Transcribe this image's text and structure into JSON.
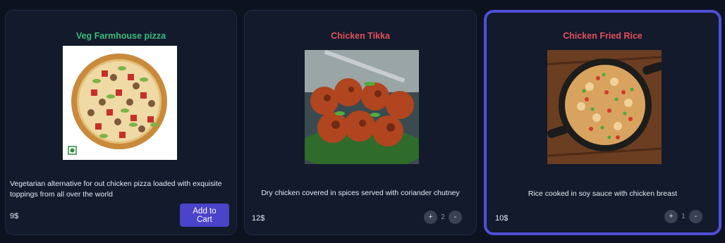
{
  "products": [
    {
      "title": "Veg Farmhouse pizza",
      "title_color": "#3dbb7a",
      "image_icon": "veg-pizza-image",
      "description": "Vegetarian alternative for out chicken pizza loaded with exquisite toppings from all over the world",
      "price": "9$",
      "action": {
        "type": "add",
        "label": "Add to Cart"
      }
    },
    {
      "title": "Chicken Tikka",
      "title_color": "#e2505a",
      "image_icon": "chicken-tikka-image",
      "description": "Dry chicken covered in spices served with coriander chutney",
      "price": "12$",
      "action": {
        "type": "stepper",
        "plus": "+",
        "quantity": "2",
        "minus": "-"
      }
    },
    {
      "title": "Chicken Fried Rice",
      "title_color": "#e2505a",
      "image_icon": "chicken-fried-rice-image",
      "description": "Rice cooked in soy sauce with chicken breast",
      "price": "10$",
      "action": {
        "type": "stepper",
        "plus": "+",
        "quantity": "1",
        "minus": "-"
      }
    }
  ],
  "colors": {
    "background": "#0d1220",
    "card": "#121a2c",
    "selected_border": "#4f4fd6",
    "button": "#4b43c9"
  }
}
